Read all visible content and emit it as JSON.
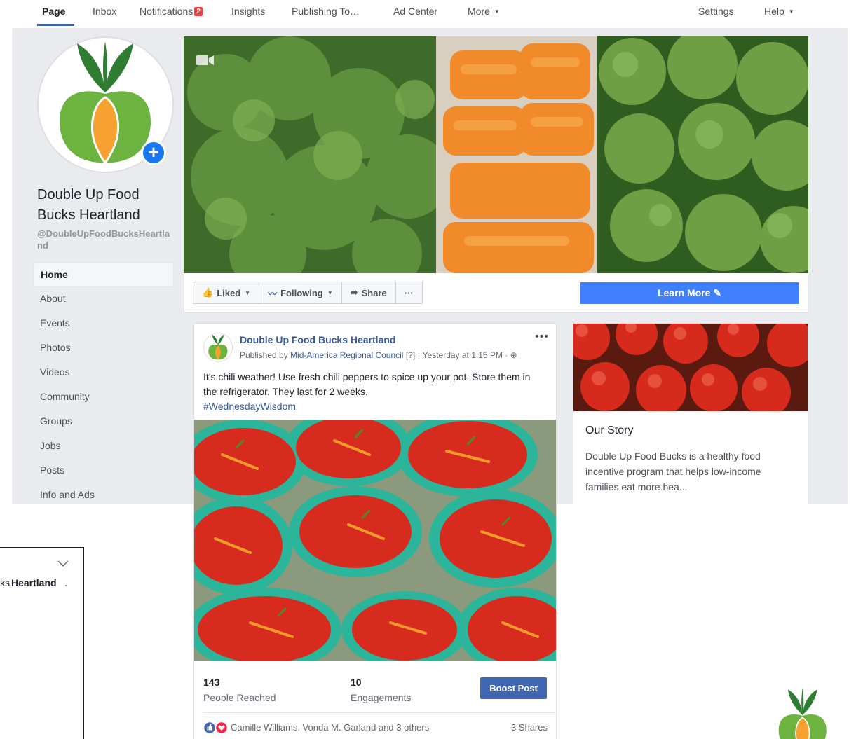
{
  "topnav": {
    "tabs": [
      {
        "label": "Page"
      },
      {
        "label": "Inbox"
      },
      {
        "label": "Notifications",
        "badge": "2"
      },
      {
        "label": "Insights"
      },
      {
        "label": "Publishing To…"
      },
      {
        "label": "Ad Center"
      },
      {
        "label": "More"
      },
      {
        "label": "Settings"
      },
      {
        "label": "Help"
      }
    ],
    "active_tab": "Page"
  },
  "page": {
    "name": "Double Up Food Bucks Heartland",
    "handle": "@DoubleUpFoodBucksHeartland"
  },
  "sidebar": {
    "items": [
      {
        "label": "Home"
      },
      {
        "label": "About"
      },
      {
        "label": "Events"
      },
      {
        "label": "Photos"
      },
      {
        "label": "Videos"
      },
      {
        "label": "Community"
      },
      {
        "label": "Groups"
      },
      {
        "label": "Jobs"
      },
      {
        "label": "Posts"
      },
      {
        "label": "Info and Ads"
      }
    ],
    "active_item": "Home"
  },
  "actions": {
    "liked": "Liked",
    "following": "Following",
    "share": "Share",
    "more_dots": "···",
    "learn_more": "Learn More"
  },
  "post": {
    "author": "Double Up Food Bucks Heartland",
    "published_by_prefix": "Published by",
    "publisher": "Mid-America Regional Council",
    "help_marker": "[?]",
    "timestamp": "· Yesterday at 1:15 PM ·",
    "text": "It's chili weather! Use fresh chili peppers to spice up your pot. Store them in the refrigerator. They last for 2 weeks.",
    "hashtag": "#WednesdayWisdom",
    "stats": {
      "reached_value": "143",
      "reached_label": "People Reached",
      "engagements_value": "10",
      "engagements_label": "Engagements"
    },
    "boost_label": "Boost Post",
    "reaction_names": "Camille Williams, Vonda M. Garland and 3 others",
    "shares": "3 Shares",
    "dots": "•••"
  },
  "story": {
    "title": "Our Story",
    "text": "Double Up Food Bucks is a healthy food incentive program that helps low-income families eat more hea..."
  },
  "popup": {
    "text_prefix": "ks",
    "text_bold": "Heartland",
    "text_suffix": "."
  },
  "colors": {
    "brand_blue": "#4267b2",
    "button_blue": "#4080ff",
    "logo_green": "#6db33f",
    "logo_orange": "#f7a130",
    "logo_leaf": "#2e7d32"
  }
}
